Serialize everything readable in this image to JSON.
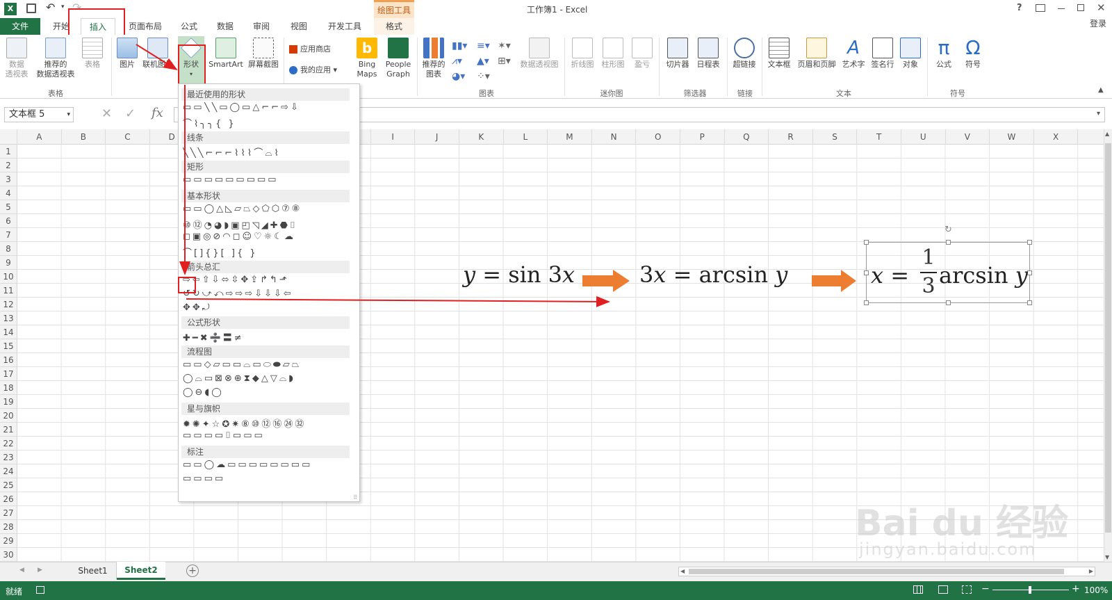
{
  "window": {
    "title": "工作簿1 - Excel",
    "context_tab_group": "绘图工具",
    "help": "?",
    "login": "登录"
  },
  "tabs": [
    "文件",
    "开始",
    "插入",
    "页面布局",
    "公式",
    "数据",
    "审阅",
    "视图",
    "开发工具",
    "格式"
  ],
  "ribbon": {
    "buttons": {
      "pivot": "数据\n透视表",
      "rec_pivot": "推荐的\n数据透视表",
      "table": "表格",
      "picture": "图片",
      "online_pic": "联机图片",
      "shapes": "形状",
      "smartart": "SmartArt",
      "screenshot": "屏幕截图",
      "store": "应用商店",
      "myapps": "我的应用",
      "bing": "Bing\nMaps",
      "people": "People\nGraph",
      "rec_chart": "推荐的\n图表",
      "pivotchart": "数据透视图",
      "spark_line": "折线图",
      "spark_col": "柱形图",
      "spark_wl": "盈亏",
      "slicer": "切片器",
      "timeline": "日程表",
      "hyperlink": "超链接",
      "textbox": "文本框",
      "headerfooter": "页眉和页脚",
      "wordart": "艺术字",
      "signature": "签名行",
      "object": "对象",
      "formula": "公式",
      "symbol": "符号"
    },
    "groups": [
      "表格",
      "图表",
      "迷你图",
      "筛选器",
      "链接",
      "文本",
      "符号"
    ]
  },
  "formula_bar": {
    "name_box": "文本框 5",
    "fx": "fx"
  },
  "columns": [
    "A",
    "B",
    "C",
    "D",
    "E",
    "F",
    "G",
    "H",
    "I",
    "J",
    "K",
    "L",
    "M",
    "N",
    "O",
    "P",
    "Q",
    "R",
    "S",
    "T",
    "U",
    "V",
    "W",
    "X"
  ],
  "rows": [
    "1",
    "2",
    "3",
    "4",
    "5",
    "6",
    "7",
    "8",
    "9",
    "10",
    "11",
    "12",
    "13",
    "14",
    "15",
    "16",
    "17",
    "18",
    "19",
    "20",
    "21",
    "22",
    "23",
    "24",
    "25",
    "26",
    "27",
    "28",
    "29",
    "30"
  ],
  "shapes_panel": {
    "sections": [
      "最近使用的形状",
      "线条",
      "矩形",
      "基本形状",
      "箭头总汇",
      "公式形状",
      "流程图",
      "星与旗帜",
      "标注"
    ],
    "recent_row1": "▭▭╲╲▭◯▭△⌐⌐⇨⇩",
    "recent_row2": "⌒⌇╮╮{ }",
    "lines_row": "╲╲╲⌐⌐⌐⌇⌇⌇⌒⌓⌇",
    "rect_row": "▭▭▭▭▭▭▭▭▭",
    "basic_row1": "▭▭◯△◺▱⏢◇⬠⬡⑦⑧",
    "basic_row2": "⑩⑫◔◕◗▣◰◹◢✚⬣⌷",
    "basic_row3": "◻▣◎⊘◠◻☺♡☼☾☁",
    "basic_row4": "⌒[]{}[ ]{ }",
    "arrows_row1": "⇨⇦⇧⇩⬄⇳✥⇪↱↰⬏",
    "arrows_row2": "↺↻⤻⤺⇨⇨⇨⇩⇩⇩⇦",
    "arrows_row3": "✥✥⤾",
    "eq_row": "✚━✖➗〓≠",
    "flow_row1": "▭▭◇▱▭▭⌓▭⬭⬬▱⏢",
    "flow_row2": "◯⌓▭⊠⊗⊕⧗◆△▽⌓◗",
    "flow_row3": "◯⊖◖◯",
    "stars_row1": "✹✺✦☆✪✷⑧⑩⑫⑯㉔㉜",
    "stars_row2": "▭▭▭▭⌷▭▭▭",
    "callout_row1": "▭▭◯☁▭▭▭▭▭▭▭▭",
    "callout_row2": "▭▭▭▭"
  },
  "equations": {
    "eq1": {
      "lhs": "y",
      "op": "=",
      "fn": "sin",
      "arg_num": "3",
      "arg_var": "x"
    },
    "eq2": {
      "lhs_num": "3",
      "lhs_var": "x",
      "op": "=",
      "fn": "arcsin",
      "arg": "y"
    },
    "eq3": {
      "lhs": "x",
      "op": "=",
      "num": "1",
      "den": "3",
      "fn": "arcsin",
      "arg": "y"
    }
  },
  "sheets": [
    "Sheet1",
    "Sheet2"
  ],
  "status": {
    "ready": "就绪",
    "zoom": "100%"
  },
  "watermark": {
    "brand": "Bai du 经验",
    "url": "jingyan.baidu.com"
  },
  "colors": {
    "excel_green": "#217346",
    "accent_orange": "#ed7d31",
    "highlight_red": "#e02020"
  }
}
